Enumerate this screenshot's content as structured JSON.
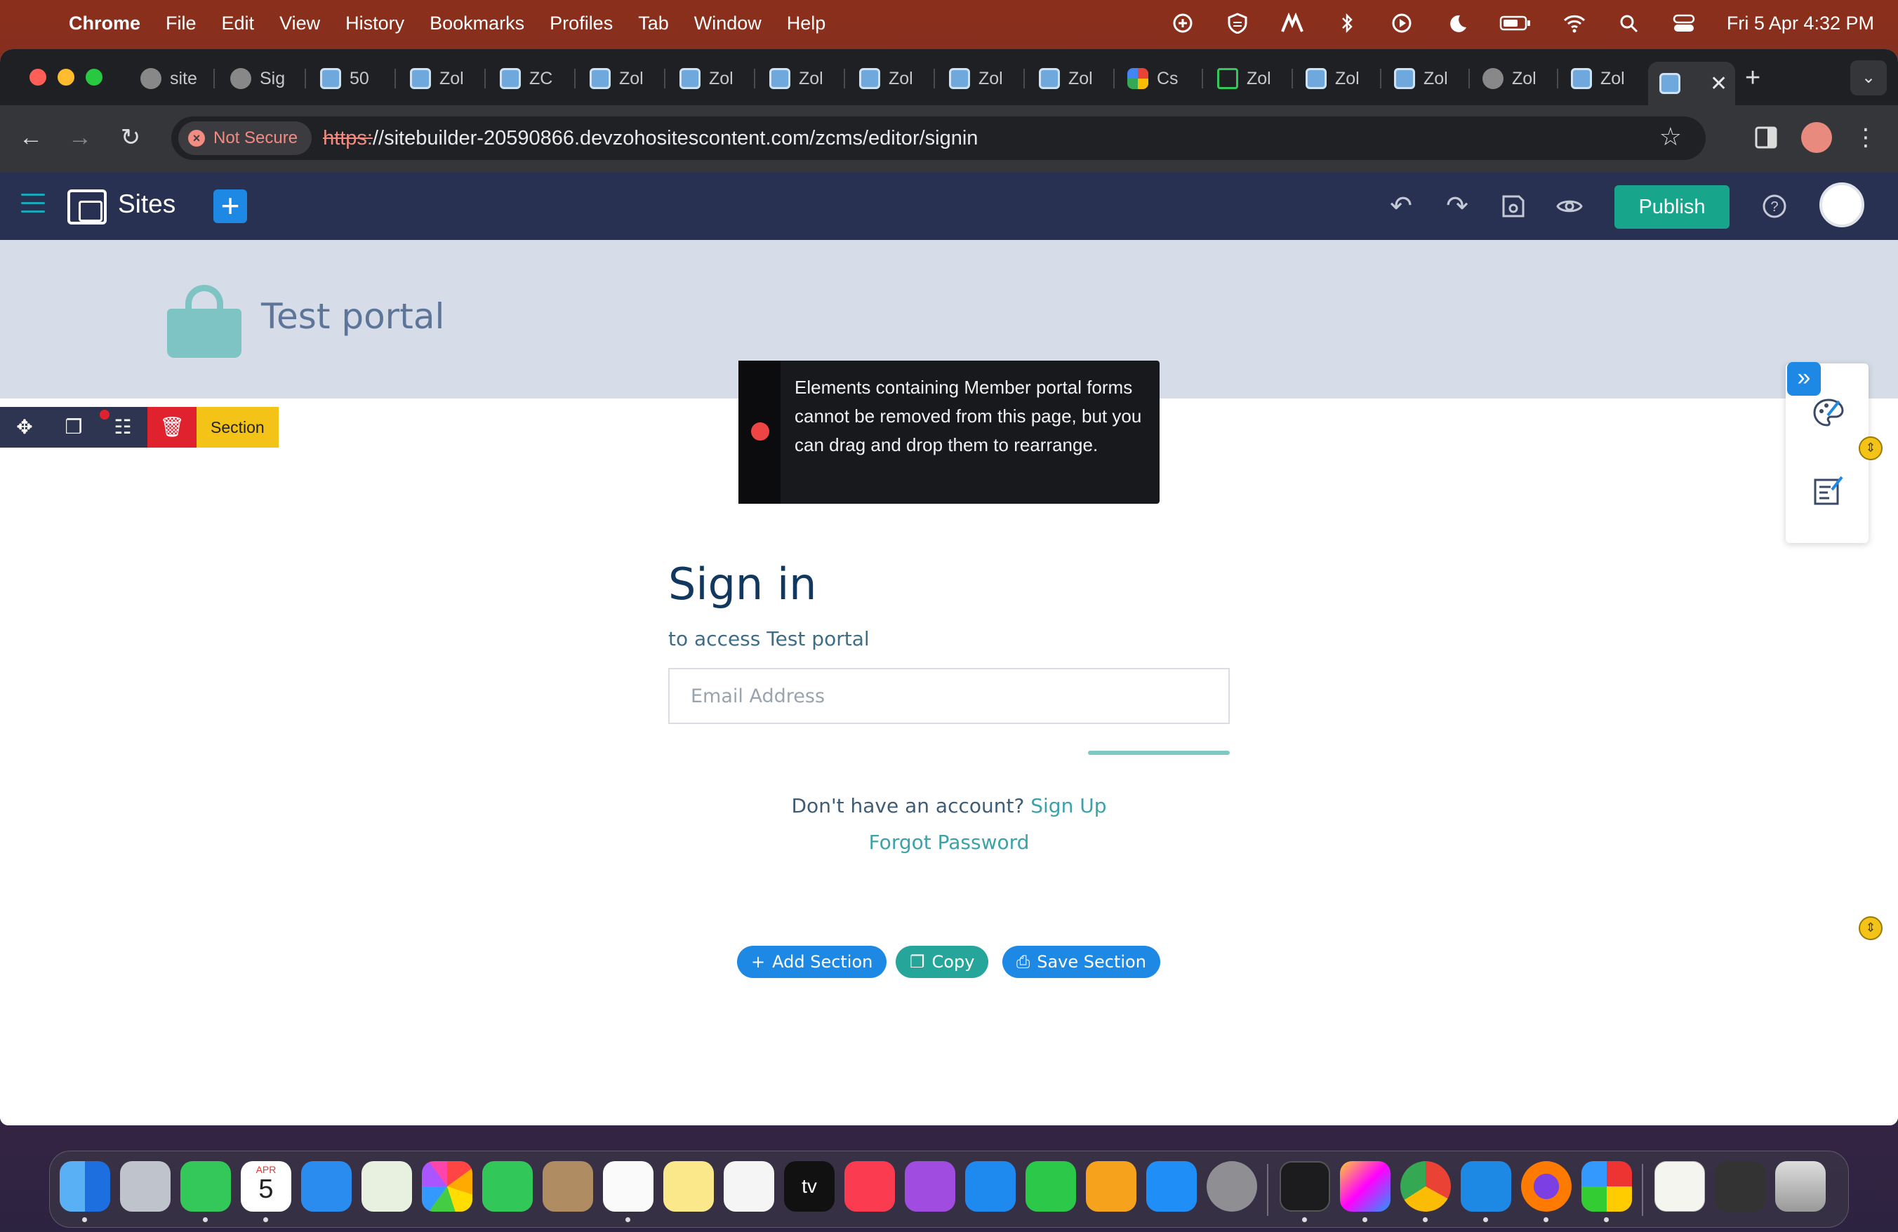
{
  "menubar": {
    "app": "Chrome",
    "items": [
      "File",
      "Edit",
      "View",
      "History",
      "Bookmarks",
      "Profiles",
      "Tab",
      "Window",
      "Help"
    ],
    "clock": "Fri 5 Apr  4:32 PM"
  },
  "tabs": [
    {
      "label": "site",
      "icon": "gear-favicon"
    },
    {
      "label": "Sig",
      "icon": "globe-favicon"
    },
    {
      "label": "50",
      "icon": "zoho-sites-favicon"
    },
    {
      "label": "Zol",
      "icon": "zoho-sites-favicon"
    },
    {
      "label": "ZC",
      "icon": "zoho-sites-favicon"
    },
    {
      "label": "Zol",
      "icon": "zoho-sites-favicon"
    },
    {
      "label": "Zol",
      "icon": "zoho-sites-favicon"
    },
    {
      "label": "Zol",
      "icon": "zoho-sites-favicon"
    },
    {
      "label": "Zol",
      "icon": "zoho-sites-favicon"
    },
    {
      "label": "Zol",
      "icon": "zoho-sites-favicon"
    },
    {
      "label": "Zol",
      "icon": "zoho-sites-favicon"
    },
    {
      "label": "Cs",
      "icon": "color-favicon"
    },
    {
      "label": "Zol",
      "icon": "bag-favicon"
    },
    {
      "label": "Zol",
      "icon": "zoho-sites-favicon"
    },
    {
      "label": "Zol",
      "icon": "zoho-sites-favicon"
    },
    {
      "label": "Zol",
      "icon": "gear-favicon"
    },
    {
      "label": "Zol",
      "icon": "zoho-sites-favicon"
    }
  ],
  "address": {
    "security_label": "Not Secure",
    "scheme": "https:",
    "rest": "//sitebuilder-20590866.devzohositescontent.com/zcms/editor/signin"
  },
  "app": {
    "title": "Sites",
    "publish_label": "Publish",
    "accent": "#17a58b"
  },
  "page": {
    "portal_title": "Test portal",
    "section_label": "Section",
    "notice": "Elements containing Member portal forms cannot be removed from this page, but you can drag and drop them to rearrange.",
    "signin_title": "Sign in",
    "signin_subtitle": "to access Test portal",
    "email_placeholder": "Email Address",
    "no_account_text": "Don't have an account?",
    "signup_link": "Sign Up",
    "forgot_link": "Forgot Password",
    "add_section": "Add Section",
    "copy": "Copy",
    "save_section": "Save Section"
  },
  "dock": {
    "calendar_month": "APR",
    "calendar_day": "5",
    "tv_label": "tv"
  }
}
